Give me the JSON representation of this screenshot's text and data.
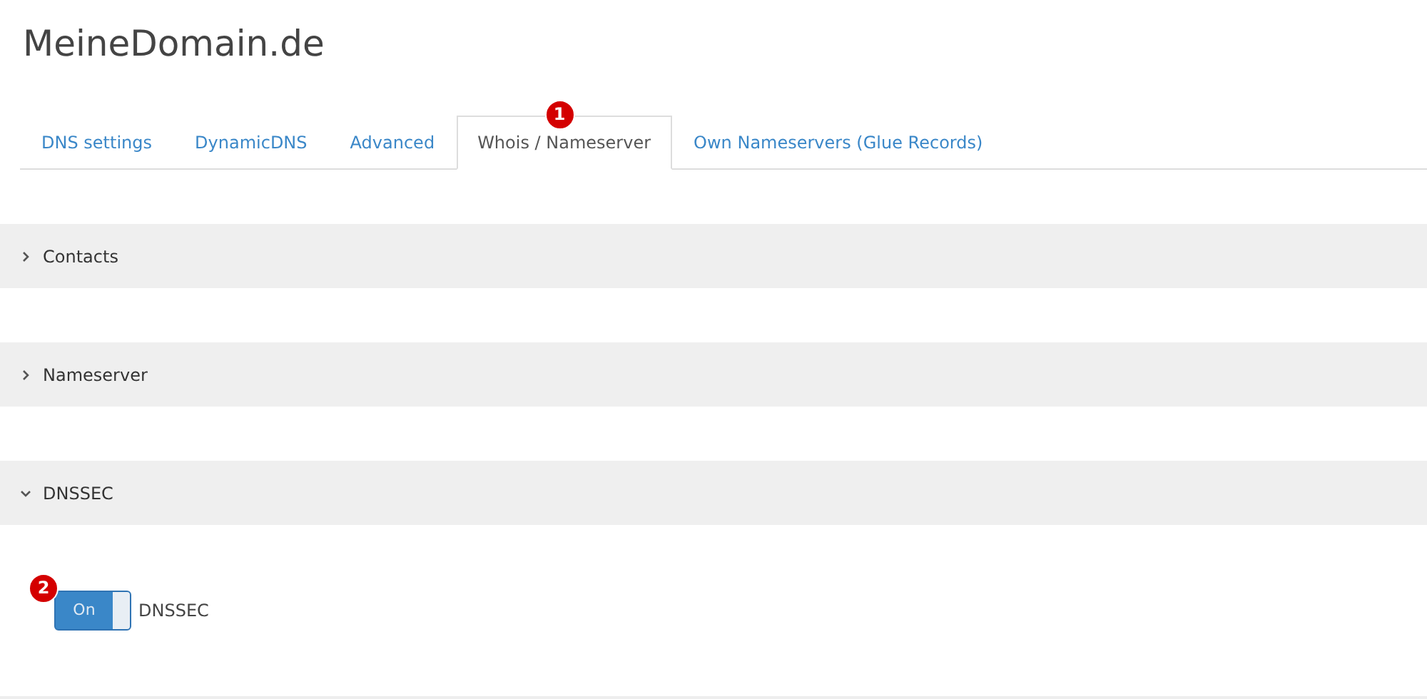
{
  "title": "MeineDomain.de",
  "tabs": [
    {
      "label": "DNS settings",
      "selected": false
    },
    {
      "label": "DynamicDNS",
      "selected": false
    },
    {
      "label": "Advanced",
      "selected": false
    },
    {
      "label": "Whois / Nameserver",
      "selected": true,
      "marker": "1"
    },
    {
      "label": "Own Nameservers (Glue Records)",
      "selected": false
    }
  ],
  "sections": [
    {
      "title": "Contacts",
      "expanded": false
    },
    {
      "title": "Nameserver",
      "expanded": false
    },
    {
      "title": "DNSSEC",
      "expanded": true,
      "toggle": {
        "on": true,
        "state_label": "On",
        "label": "DNSSEC",
        "marker": "2"
      }
    }
  ]
}
